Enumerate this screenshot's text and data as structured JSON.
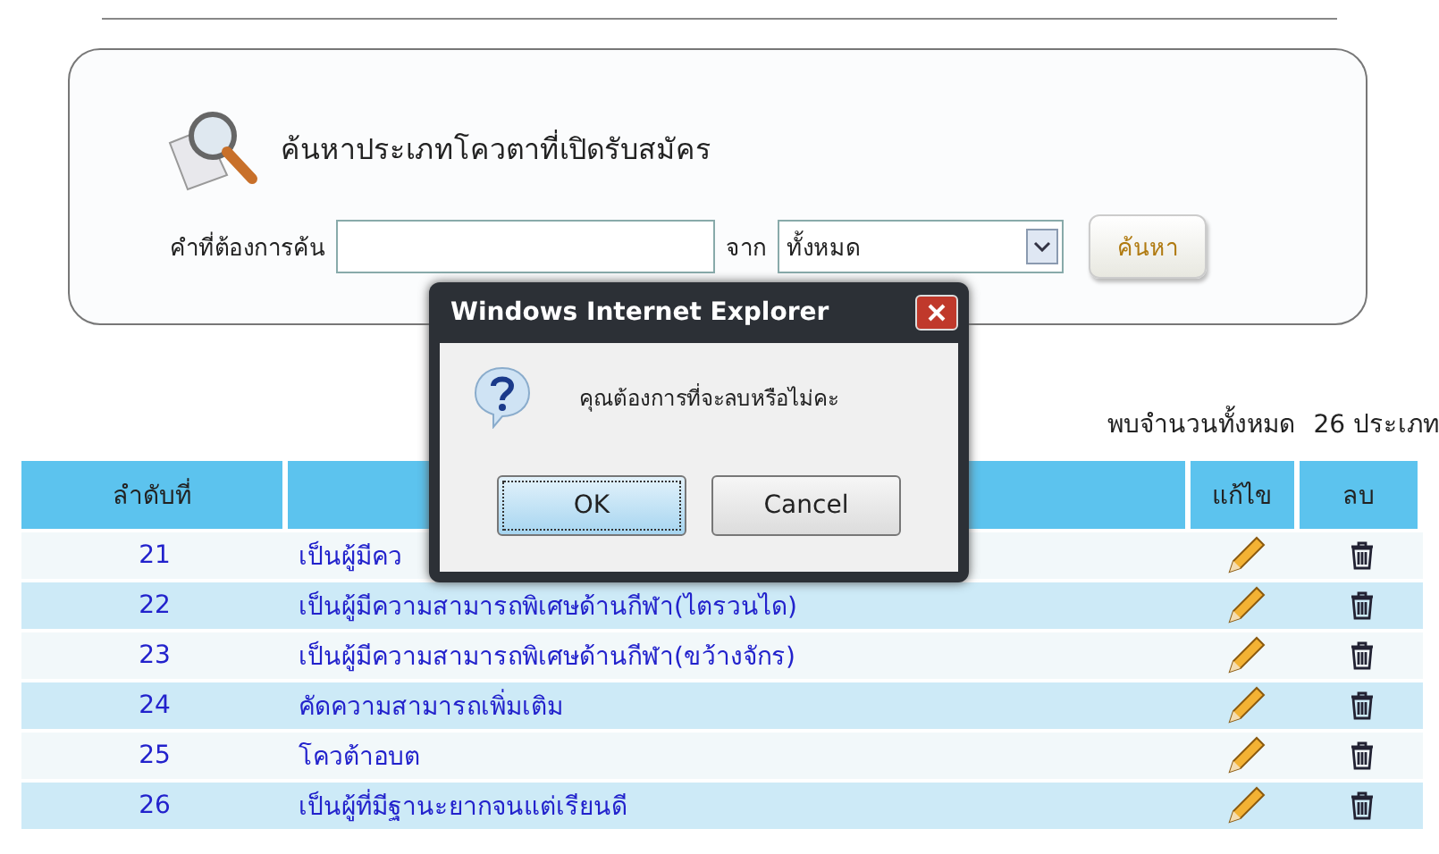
{
  "search_panel": {
    "title": "ค้นหาประเภทโควตาที่เปิดรับสมัคร",
    "keyword_label": "คำที่ต้องการค้น",
    "from_label": "จาก",
    "category_value": "ทั้งหมด",
    "search_button": "ค้นหา"
  },
  "result_count": {
    "label": "พบจำนวนทั้งหมด",
    "value": "26 ประเภท"
  },
  "table": {
    "columns": [
      "ลำดับที่",
      "แก้ไข",
      "ลบ"
    ],
    "rows": [
      {
        "number": "21",
        "name": "เป็นผู้มีคว"
      },
      {
        "number": "22",
        "name": "เป็นผู้มีความสามารถพิเศษด้านกีฬา(ไตรวนได)"
      },
      {
        "number": "23",
        "name": "เป็นผู้มีความสามารถพิเศษด้านกีฬา(ขว้างจักร)"
      },
      {
        "number": "24",
        "name": "คัดความสามารถเพิ่มเติม"
      },
      {
        "number": "25",
        "name": "โควต้าอบต"
      },
      {
        "number": "26",
        "name": "เป็นผู้ที่มีฐานะยากจนแต่เรียนดี"
      }
    ]
  },
  "dialog": {
    "title": "Windows Internet Explorer",
    "message": "คุณต้องการที่จะลบหรือไม่คะ",
    "buttons": [
      {
        "label": "OK",
        "selected": true
      },
      {
        "label": "Cancel",
        "selected": false
      }
    ]
  }
}
